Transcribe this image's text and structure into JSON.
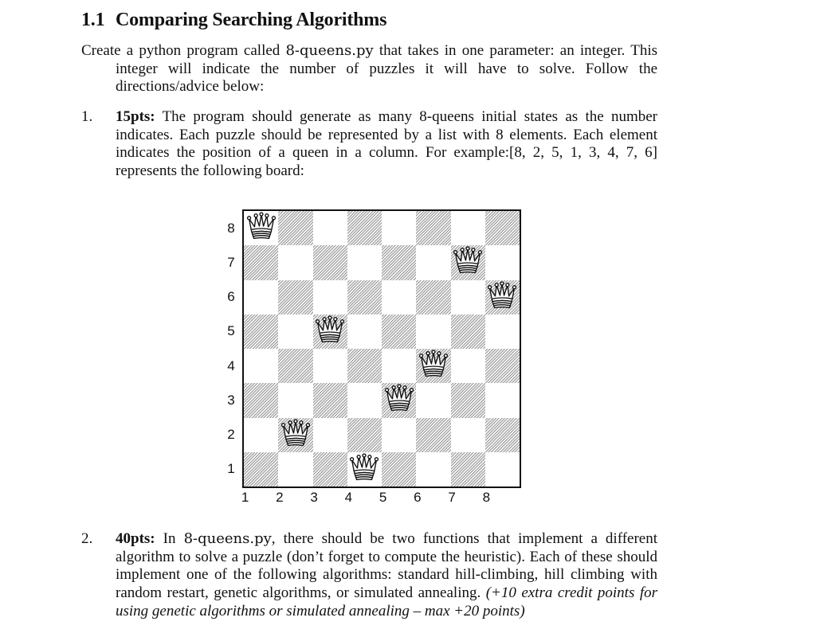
{
  "heading": {
    "number": "1.1",
    "title": "Comparing Searching Algorithms"
  },
  "intro": {
    "text_before": "Create a python program called ",
    "filename": "8-queens.py",
    "text_after": " that takes in one parameter: an integer. This integer will indicate the number of puzzles it will have to solve. Follow the directions/advice below:"
  },
  "items": [
    {
      "marker": "1.",
      "points": "15pts:",
      "text": " The program should generate as many 8-queens initial states as the number indicates. Each puzzle should be represented by a list with 8 elements. Each element indicates the position of a queen in a column. For example:[8, 2, 5, 1, 3, 4, 7, 6] represents the following board:"
    },
    {
      "marker": "2.",
      "points": "40pts:",
      "text_before": " In ",
      "filename": "8-queens.py",
      "text_after": ", there should be two functions that implement a different algorithm to solve a puzzle (don’t forget to compute the heuristic). Each of these should implement one of the following algorithms: standard hill-climbing, hill climbing with random restart, genetic algorithms, or simulated annealing. ",
      "italic_note": "(+10 extra credit points for using genetic algorithms or simulated annealing – max +20 points)"
    }
  ],
  "board": {
    "size": 8,
    "queens_by_column": [
      8,
      2,
      5,
      1,
      3,
      4,
      7,
      6
    ],
    "rank_labels": [
      "8",
      "7",
      "6",
      "5",
      "4",
      "3",
      "2",
      "1"
    ],
    "file_labels": [
      "1",
      "2",
      "3",
      "4",
      "5",
      "6",
      "7",
      "8"
    ],
    "piece_icon": "queen-icon",
    "hatch_color": "#a8a8a8"
  }
}
